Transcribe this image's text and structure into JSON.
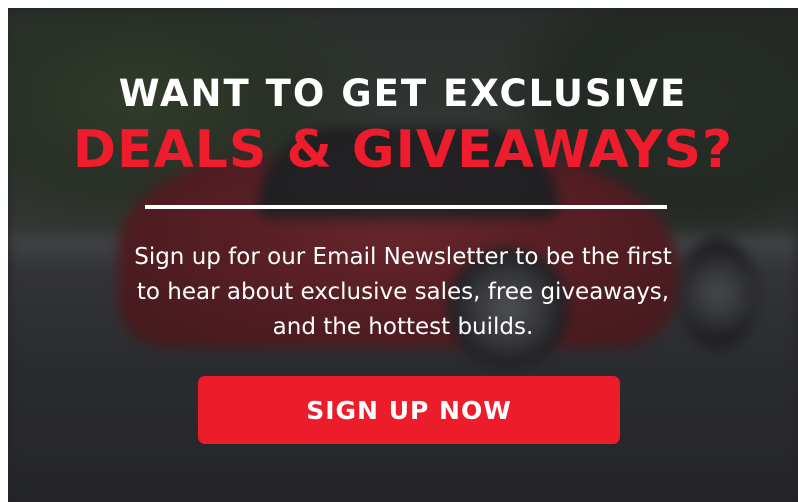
{
  "banner": {
    "headline_line1": "WANT TO GET EXCLUSIVE",
    "headline_line2": "DEALS & GIVEAWAYS?",
    "body_line1": "Sign up for our Email Newsletter to be the first",
    "body_line2": "to hear about exclusive sales, free giveaways,",
    "body_line3": "and the hottest builds.",
    "cta_label": "SIGN UP NOW"
  },
  "colors": {
    "accent": "#ED1C2A",
    "headline_white": "#FFFFFF",
    "overlay": "#1E1E22"
  }
}
